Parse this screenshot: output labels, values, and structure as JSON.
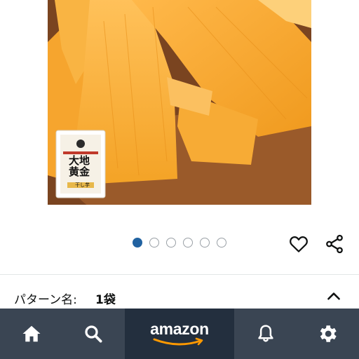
{
  "product": {
    "package": {
      "title_line1": "大地",
      "title_line2": "黄金",
      "subtitle": "干し芋"
    }
  },
  "carousel": {
    "total": 6,
    "active_index": 0
  },
  "variation": {
    "label": "パターン名:",
    "value": "1袋"
  },
  "bottom_nav": {
    "logo_text": "amazon",
    "items": [
      {
        "icon": "home-icon"
      },
      {
        "icon": "search-icon"
      },
      {
        "icon": "amazon-logo"
      },
      {
        "icon": "bell-icon"
      },
      {
        "icon": "gear-icon"
      }
    ]
  },
  "colors": {
    "accent_blue": "#2162a1",
    "nav_bg": "#3a4553",
    "logo_bg": "#232f3e",
    "smile_orange": "#ff9900"
  }
}
